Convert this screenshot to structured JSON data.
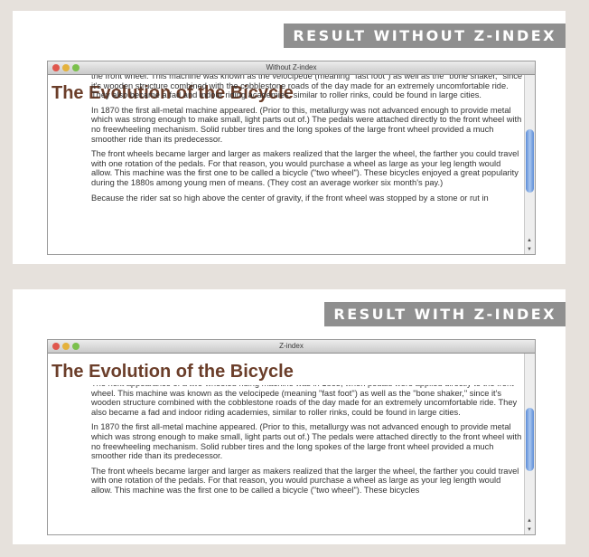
{
  "top": {
    "badge": "RESULT WITHOUT Z-INDEX",
    "window_title": "Without Z-index"
  },
  "bottom": {
    "badge": "RESULT WITH Z-INDEX",
    "window_title": "Z-index"
  },
  "heading": "The Evolution of the Bicycle",
  "top_paragraphs": [
    "the front wheel. This machine was known as the velocipede (meaning \"fast foot\") as well as the \"bone shaker,\" since it's wooden structure combined with the cobblestone roads of the day made for an extremely uncomfortable ride. They also became a fad and indoor riding academies, similar to roller rinks, could be found in large cities.",
    "In 1870 the first all-metal machine appeared. (Prior to this, metallurgy was not advanced enough to provide metal which was strong enough to make small, light parts out of.) The pedals were attached directly to the front wheel with no freewheeling mechanism. Solid rubber tires and the long spokes of the large front wheel provided a much smoother ride than its predecessor.",
    "The front wheels became larger and larger as makers realized that the larger the wheel, the farther you could travel with one rotation of the pedals. For that reason, you would purchase a wheel as large as your leg length would allow. This machine was the first one to be called a bicycle (\"two wheel\"). These bicycles enjoyed a great popularity during the 1880s among young men of means. (They cost an average worker six month's pay.)",
    "Because the rider sat so high above the center of gravity, if the front wheel was stopped by a stone or rut in"
  ],
  "bottom_paragraphs": [
    "The next appearance of a two-wheeled riding machine was in 1865, when pedals were applied directly to the front wheel. This machine was known as the velocipede (meaning \"fast foot\") as well as the \"bone shaker,\" since it's wooden structure combined with the cobblestone roads of the day made for an extremely uncomfortable ride. They also became a fad and indoor riding academies, similar to roller rinks, could be found in large cities.",
    "In 1870 the first all-metal machine appeared. (Prior to this, metallurgy was not advanced enough to provide metal which was strong enough to make small, light parts out of.) The pedals were attached directly to the front wheel with no freewheeling mechanism. Solid rubber tires and the long spokes of the large front wheel provided a much smoother ride than its predecessor.",
    "The front wheels became larger and larger as makers realized that the larger the wheel, the farther you could travel with one rotation of the pedals. For that reason, you would purchase a wheel as large as your leg length would allow. This machine was the first one to be called a bicycle (\"two wheel\"). These bicycles"
  ],
  "colors": {
    "badge_bg": "#8f8f8f",
    "heading": "#6b3e2a",
    "page_bg": "#e6e1dc"
  }
}
